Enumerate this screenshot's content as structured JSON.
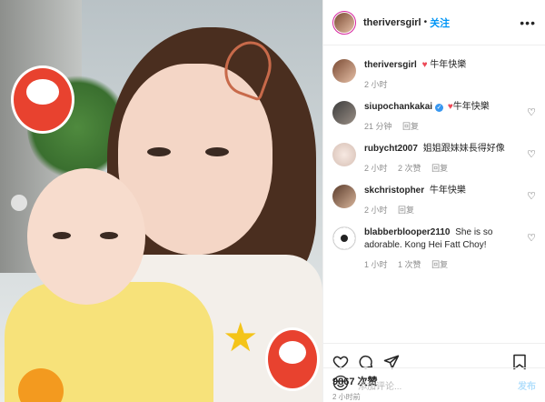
{
  "header": {
    "username": "theriversgirl",
    "separator": "•",
    "follow_label": "关注",
    "more_label": "•••"
  },
  "caption": {
    "username": "theriversgirl",
    "text": "牛年快樂",
    "time": "2 小时"
  },
  "comments": [
    {
      "username": "siupochankakai",
      "verified": true,
      "text": "牛年快樂",
      "time": "21 分钟",
      "likes": "",
      "reply": "回复"
    },
    {
      "username": "rubycht2007",
      "verified": false,
      "text": "姐姐跟妹妹長得好像",
      "time": "2 小时",
      "likes": "2 次赞",
      "reply": "回复"
    },
    {
      "username": "skchristopher",
      "verified": false,
      "text": "牛年快樂",
      "time": "2 小时",
      "likes": "",
      "reply": "回复"
    },
    {
      "username": "blabberblooper2110",
      "verified": false,
      "text": "She is so adorable. Kong Hei Fatt Choy!",
      "time": "1 小时",
      "likes": "1 次赞",
      "reply": "回复"
    }
  ],
  "likes": {
    "count_text": "9867 次赞"
  },
  "timestamp": "2 小时前",
  "add_comment": {
    "placeholder": "添加评论...",
    "post_label": "发布"
  },
  "icons": {
    "like": "heart-icon",
    "comment": "comment-icon",
    "share": "paper-plane-icon",
    "save": "bookmark-icon",
    "emoji": "emoji-icon"
  },
  "colors": {
    "accent": "#0095f6",
    "heart_red": "#ed4956",
    "muted": "#8e8e8e"
  }
}
